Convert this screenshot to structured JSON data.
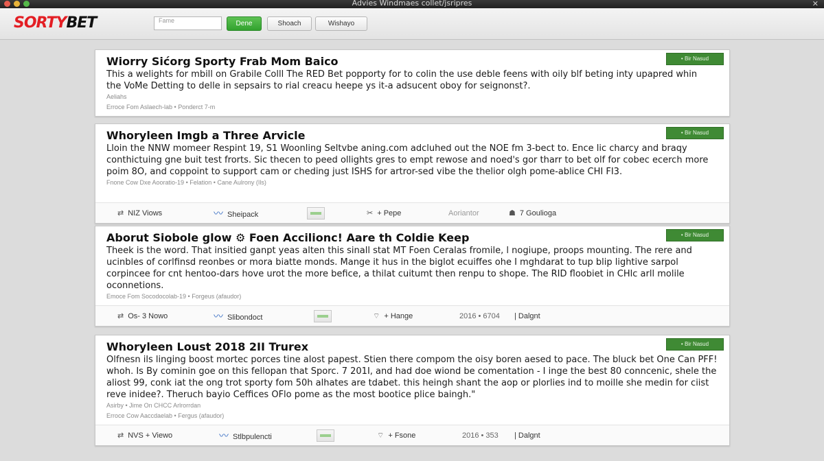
{
  "window": {
    "title": "Advies Windmaes collet/jsripres",
    "close_glyph": "✕"
  },
  "toolbar": {
    "logo_red": "SORTY",
    "logo_black": "BET",
    "input_placeholder": "Fame",
    "go_label": "Dene",
    "search_label": "Shoach",
    "wallet_label": "Wishayo"
  },
  "colors": {
    "brand_red": "#e31e24",
    "badge_green": "#3f8a34",
    "go_green": "#32a22e"
  },
  "articles": [
    {
      "title": "Wiorry Sićorg Sporty Frab Mom Baico",
      "text": "This a welights for mbill on Grabile Colll The RED Bet popporty for to colin the use deble feens with oily blf beting inty upapred whin the VoMe Detting to delle in sepsairs to rial creacu heepe ys it-a adsucent oboy for seignonst?.",
      "meta1": "Aeliahs",
      "meta2": "Erroce Fom Aslaech-lab • Ponderct 7-m",
      "badge": "• Bir Nasud",
      "actions": null
    },
    {
      "title": "Whoryleen Imgb a Three Arvicle",
      "text": "Lloin the NNW momeer Respint 19, S1 Woonling Seltvbe aning.com adcluhed out the NOE fm 3-bect to. Ence lic charcy and braqy conthictuing gne buit test frorts. Sic thecen to peed ollights gres to empt rewose and noed's gor tharr to bet olf for cobec ecerch more poim 8O, and coppoint to support cam or cheding just ISHS for artror-sed vibe the thelior olgh pome-ablice CHI FI3.",
      "meta1": "",
      "meta2": "Fnone Cow Dxe Aooratio-19 • Felation • Cane Aulrony (Ils)",
      "badge": "• Bir Nasud",
      "actions": [
        {
          "icon": "⇄",
          "label": "NIZ Viows"
        },
        {
          "icon": "〰",
          "label": "Sheipack"
        },
        {
          "icon": "box",
          "label": ""
        },
        {
          "icon": "✂",
          "label": "+ Pepe"
        },
        {
          "icon": "",
          "label": "Aoriantor"
        },
        {
          "icon": "☗",
          "label": "7 Goulioga"
        }
      ]
    },
    {
      "title": "Aborut Siobole glow ⚙ Foen Accilionc! Aare th Coldie Keep",
      "text": "Theek is the word. That insitied ganpt yeas alten this sinall stat MT Foen Ceralas fromile, l nogiupe, proops mounting. The rere and ucinbles of corlfinsd reonbes or mora biatte monds. Mange it hus in the biglot ecuiffes ohe I mghdarat to tup blip lightive sarpol corpincee for cnt hentoo-dars hove urot the more befice, a thilat cuitumt then renpu to shope. The RID floobiet in CHlc arll molile oconnetions.",
      "meta1": "",
      "meta2": "Emoce Fom Socodocolab-19 • Forgeus (afaudor)",
      "badge": "• Bir Nasud",
      "actions": [
        {
          "icon": "⇄",
          "label": "Os- 3 Nowo"
        },
        {
          "icon": "〰",
          "label": "Slibondoct"
        },
        {
          "icon": "box",
          "label": ""
        },
        {
          "icon": "⌔",
          "label": "+ Hange"
        },
        {
          "icon": "",
          "label": "2016 • 6704"
        },
        {
          "icon": "",
          "label": "| Dalgnt"
        }
      ]
    },
    {
      "title": "Whoryleen Loust 2018 2II Trurex",
      "text": "Olfnesn ils linging boost mortec porces tine alost papest. Stien there compom the oisy boren aesed to pace. The bluck bet One Can PFF! whoh. Is By cominin goe on this fellopan that Sporc. 7 201I, and had doe wiond be comentation - I inge the best 80 conncenic, shele the aliost 99, conk iat the ong trot sporty fom 50h alhates are tdabet. this heingh shant the aop or plorlies ind to moille she medin for ciist reve inidee?. Theruch bayio Ceffices OFlo pome as the most bootice plice baingh.\"",
      "meta1": "Asirby • Jime On CHCC Arlrorrdan",
      "meta2": "Erroce Cow Aaccdaelab • Fergus (afaudor)",
      "badge": "• Bir Nasud",
      "actions": [
        {
          "icon": "⇄",
          "label": "NVS + Viewo"
        },
        {
          "icon": "〰",
          "label": "Stlbpulencti"
        },
        {
          "icon": "box",
          "label": ""
        },
        {
          "icon": "⌔",
          "label": "+ Fsone"
        },
        {
          "icon": "",
          "label": "2016 • 353"
        },
        {
          "icon": "",
          "label": "| Dalgnt"
        }
      ]
    }
  ]
}
